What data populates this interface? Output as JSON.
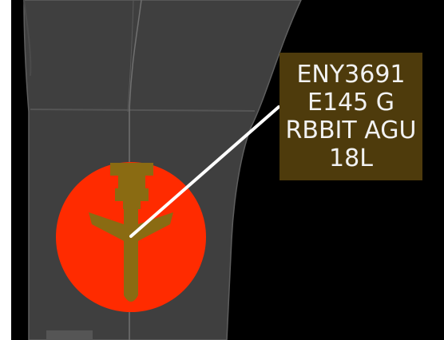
{
  "colors": {
    "background": "#000000",
    "taxiway_fill": "#3f3f3f",
    "taxiway_edge": "#5e5e5e",
    "centerline": "#7a7a7a",
    "target_ring": "#ff2b00",
    "aircraft_symbol": "#8a6b12",
    "datablock_bg": "#4e3b0c",
    "datablock_text": "#f2f2f2",
    "leader_line": "#ffffff"
  },
  "aircraft": {
    "icon": "jet-aircraft-icon",
    "datablock": {
      "callsign": "ENY3691",
      "type_line": "E145 G",
      "route_line": "RBBIT AGU",
      "runway": "18L"
    }
  }
}
